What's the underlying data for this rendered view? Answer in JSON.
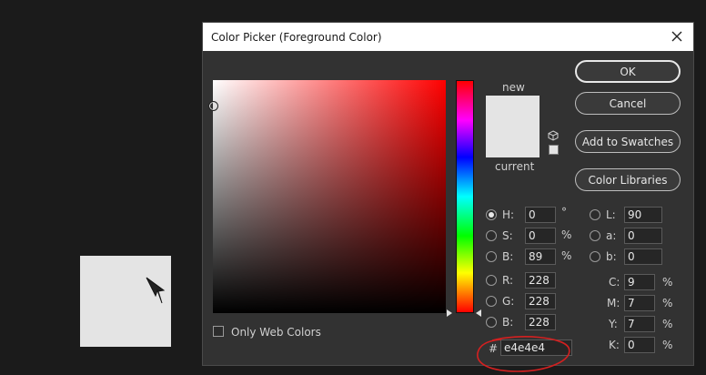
{
  "dialog": {
    "title": "Color Picker (Foreground Color)"
  },
  "preview": {
    "new_label": "new",
    "current_label": "current",
    "color": "#e4e4e4"
  },
  "buttons": {
    "ok": "OK",
    "cancel": "Cancel",
    "add_to_swatches": "Add to Swatches",
    "color_libraries": "Color Libraries"
  },
  "hsb": {
    "h": {
      "label": "H:",
      "value": "0",
      "unit": "°"
    },
    "s": {
      "label": "S:",
      "value": "0",
      "unit": "%"
    },
    "b": {
      "label": "B:",
      "value": "89",
      "unit": "%"
    }
  },
  "rgb": {
    "r": {
      "label": "R:",
      "value": "228"
    },
    "g": {
      "label": "G:",
      "value": "228"
    },
    "b": {
      "label": "B:",
      "value": "228"
    }
  },
  "lab": {
    "l": {
      "label": "L:",
      "value": "90"
    },
    "a": {
      "label": "a:",
      "value": "0"
    },
    "b": {
      "label": "b:",
      "value": "0"
    }
  },
  "cmyk": {
    "c": {
      "label": "C:",
      "value": "9",
      "unit": "%"
    },
    "m": {
      "label": "M:",
      "value": "7",
      "unit": "%"
    },
    "y": {
      "label": "Y:",
      "value": "7",
      "unit": "%"
    },
    "k": {
      "label": "K:",
      "value": "0",
      "unit": "%"
    }
  },
  "hex": {
    "label": "#",
    "value": "e4e4e4"
  },
  "only_web_colors": "Only Web Colors",
  "colors": {
    "accent_red": "#d42020",
    "foreground": "#e4e4e4"
  }
}
